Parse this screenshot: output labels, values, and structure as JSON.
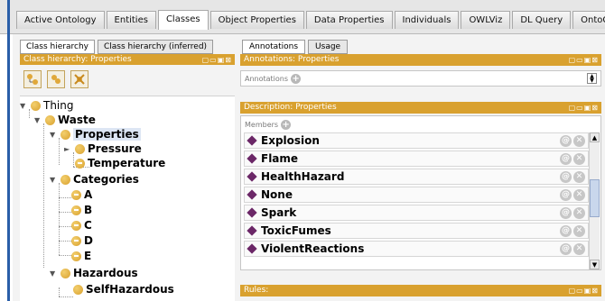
{
  "top_tabs": [
    "Active Ontology",
    "Entities",
    "Classes",
    "Object Properties",
    "Data Properties",
    "Individuals",
    "OWLViz",
    "DL Query",
    "OntoGraf"
  ],
  "active_top_tab": "Classes",
  "left": {
    "subtabs": [
      "Class hierarchy",
      "Class hierarchy (inferred)"
    ],
    "view_title": "Class hierarchy: Properties",
    "window_controls": "▢▭▣⊠",
    "tree": {
      "thing": "Thing",
      "waste": "Waste",
      "properties": "Properties",
      "pressure": "Pressure",
      "temperature": "Temperature",
      "categories": "Categories",
      "a": "A",
      "b": "B",
      "c": "C",
      "d": "D",
      "e": "E",
      "hazardous": "Hazardous",
      "selfhazardous": "SelfHazardous"
    }
  },
  "right": {
    "tabs": [
      "Annotations",
      "Usage"
    ],
    "annotations_title": "Annotations: Properties",
    "annotations_label": "Annotations",
    "description_title": "Description: Properties",
    "members_label": "Members",
    "members": [
      "Explosion",
      "Flame",
      "HealthHazard",
      "None",
      "Spark",
      "ToxicFumes",
      "ViolentReactions"
    ],
    "rules_title": "Rules:",
    "window_controls": "▢▭▣⊠"
  },
  "colors": {
    "view_header": "#d9a12f",
    "individual_diamond": "#6b2767",
    "class_dot": "#e2ad3b"
  }
}
